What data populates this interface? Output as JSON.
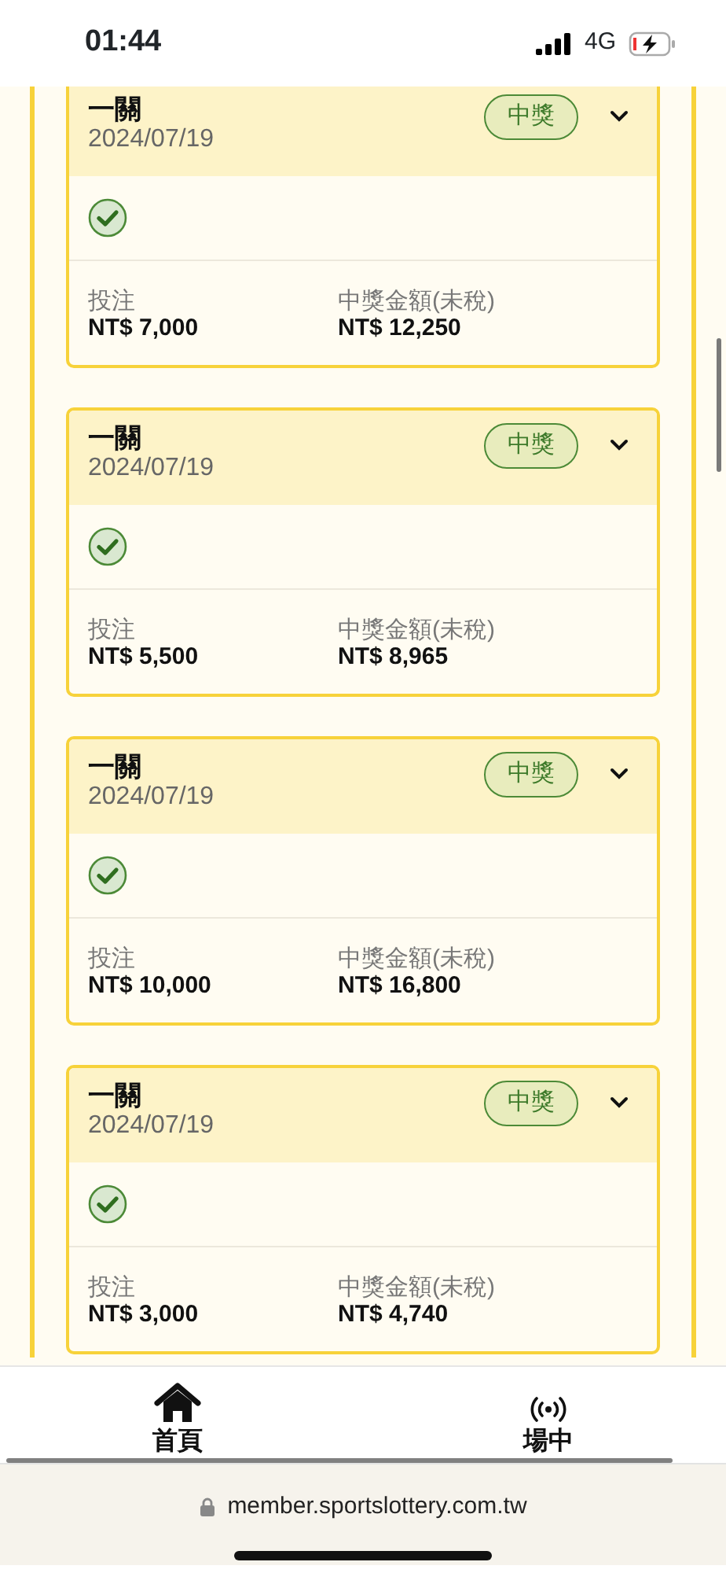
{
  "status_bar": {
    "time": "01:44",
    "network": "4G"
  },
  "bets": [
    {
      "title": "一關",
      "date": "2024/07/19",
      "badge": "中獎",
      "stake_label": "投注",
      "stake": "NT$ 7,000",
      "payout_label": "中獎金額(未稅)",
      "payout": "NT$ 12,250"
    },
    {
      "title": "一關",
      "date": "2024/07/19",
      "badge": "中獎",
      "stake_label": "投注",
      "stake": "NT$ 5,500",
      "payout_label": "中獎金額(未稅)",
      "payout": "NT$ 8,965"
    },
    {
      "title": "一關",
      "date": "2024/07/19",
      "badge": "中獎",
      "stake_label": "投注",
      "stake": "NT$ 10,000",
      "payout_label": "中獎金額(未稅)",
      "payout": "NT$ 16,800"
    },
    {
      "title": "一關",
      "date": "2024/07/19",
      "badge": "中獎",
      "stake_label": "投注",
      "stake": "NT$ 3,000",
      "payout_label": "中獎金額(未稅)",
      "payout": "NT$ 4,740"
    }
  ],
  "bottom_nav": [
    {
      "kind": "home",
      "label": "首頁"
    },
    {
      "kind": "live",
      "label": "場中"
    }
  ],
  "url_bar": {
    "url": "member.sportslottery.com.tw"
  }
}
